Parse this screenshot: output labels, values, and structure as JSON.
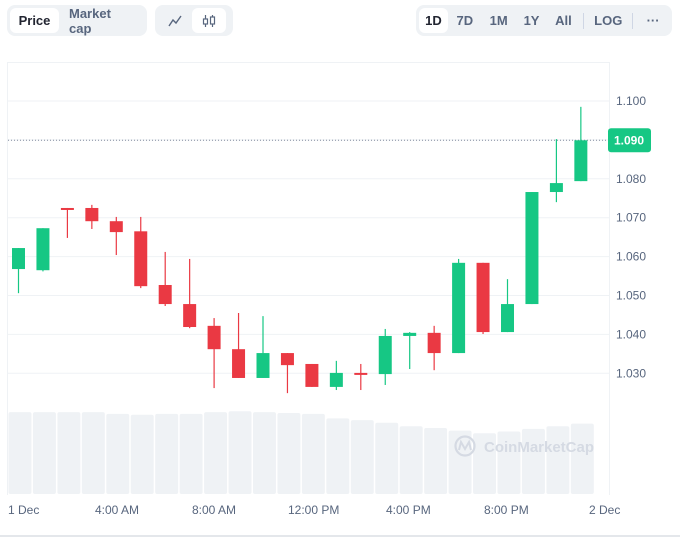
{
  "toolbar": {
    "type_tabs": [
      {
        "label": "Price",
        "active": true
      },
      {
        "label": "Market cap",
        "active": false
      }
    ],
    "chart_types": [
      {
        "icon": "line-chart-icon",
        "active": false
      },
      {
        "icon": "candlestick-icon",
        "active": true
      }
    ],
    "ranges": [
      {
        "label": "1D",
        "active": true
      },
      {
        "label": "7D",
        "active": false
      },
      {
        "label": "1M",
        "active": false
      },
      {
        "label": "1Y",
        "active": false
      },
      {
        "label": "All",
        "active": false
      }
    ],
    "log_label": "LOG",
    "more_label": "···"
  },
  "watermark": "CoinMarketCap",
  "colors": {
    "up": "#16c784",
    "down": "#ea3943",
    "grid": "#eff2f5",
    "volume": "#eff2f5",
    "axis_text": "#58667e"
  },
  "chart_data": {
    "type": "candlestick",
    "title": "",
    "xlabel": "",
    "ylabel": "",
    "ylim": [
      1.0215,
      1.1115
    ],
    "y_ticks": [
      "1.030",
      "1.040",
      "1.050",
      "1.060",
      "1.070",
      "1.080",
      "1.090",
      "1.100"
    ],
    "x_ticks": [
      "1 Dec",
      "4:00 AM",
      "8:00 AM",
      "12:00 PM",
      "4:00 PM",
      "8:00 PM",
      "2 Dec"
    ],
    "current_price": "1.090",
    "current_price_value": 1.0899,
    "grid": true,
    "candles": [
      {
        "o": 1.0568,
        "h": 1.0622,
        "l": 1.0506,
        "c": 1.0622
      },
      {
        "o": 1.0565,
        "h": 1.0673,
        "l": 1.0562,
        "c": 1.0673
      },
      {
        "o": 1.0725,
        "h": 1.0725,
        "l": 1.0648,
        "c": 1.0721
      },
      {
        "o": 1.0725,
        "h": 1.0733,
        "l": 1.0671,
        "c": 1.0691
      },
      {
        "o": 1.0691,
        "h": 1.0702,
        "l": 1.0604,
        "c": 1.0663
      },
      {
        "o": 1.0665,
        "h": 1.0702,
        "l": 1.0519,
        "c": 1.0524
      },
      {
        "o": 1.0527,
        "h": 1.0612,
        "l": 1.0473,
        "c": 1.0478
      },
      {
        "o": 1.0478,
        "h": 1.0594,
        "l": 1.0416,
        "c": 1.0419
      },
      {
        "o": 1.0422,
        "h": 1.0442,
        "l": 1.0262,
        "c": 1.0362
      },
      {
        "o": 1.0362,
        "h": 1.0455,
        "l": 1.0288,
        "c": 1.0288
      },
      {
        "o": 1.0288,
        "h": 1.0447,
        "l": 1.0288,
        "c": 1.0352
      },
      {
        "o": 1.0352,
        "h": 1.0352,
        "l": 1.0249,
        "c": 1.0321
      },
      {
        "o": 1.0324,
        "h": 1.0324,
        "l": 1.0265,
        "c": 1.0265
      },
      {
        "o": 1.0265,
        "h": 1.0332,
        "l": 1.0257,
        "c": 1.0301
      },
      {
        "o": 1.0301,
        "h": 1.0324,
        "l": 1.0257,
        "c": 1.0298
      },
      {
        "o": 1.0298,
        "h": 1.0414,
        "l": 1.027,
        "c": 1.0396
      },
      {
        "o": 1.0396,
        "h": 1.0406,
        "l": 1.0311,
        "c": 1.0404
      },
      {
        "o": 1.0404,
        "h": 1.0422,
        "l": 1.0308,
        "c": 1.0352
      },
      {
        "o": 1.0352,
        "h": 1.0594,
        "l": 1.0352,
        "c": 1.0584
      },
      {
        "o": 1.0584,
        "h": 1.0584,
        "l": 1.0401,
        "c": 1.0406
      },
      {
        "o": 1.0406,
        "h": 1.0542,
        "l": 1.0406,
        "c": 1.0478
      },
      {
        "o": 1.0478,
        "h": 1.0766,
        "l": 1.0478,
        "c": 1.0766
      },
      {
        "o": 1.0766,
        "h": 1.0902,
        "l": 1.074,
        "c": 1.0789
      },
      {
        "o": 1.0794,
        "h": 1.0985,
        "l": 1.0794,
        "c": 1.0899
      }
    ],
    "volume": [
      0.93,
      0.93,
      0.93,
      0.93,
      0.91,
      0.9,
      0.91,
      0.91,
      0.93,
      0.94,
      0.93,
      0.92,
      0.91,
      0.86,
      0.84,
      0.81,
      0.77,
      0.75,
      0.72,
      0.69,
      0.71,
      0.74,
      0.77,
      0.8
    ]
  }
}
